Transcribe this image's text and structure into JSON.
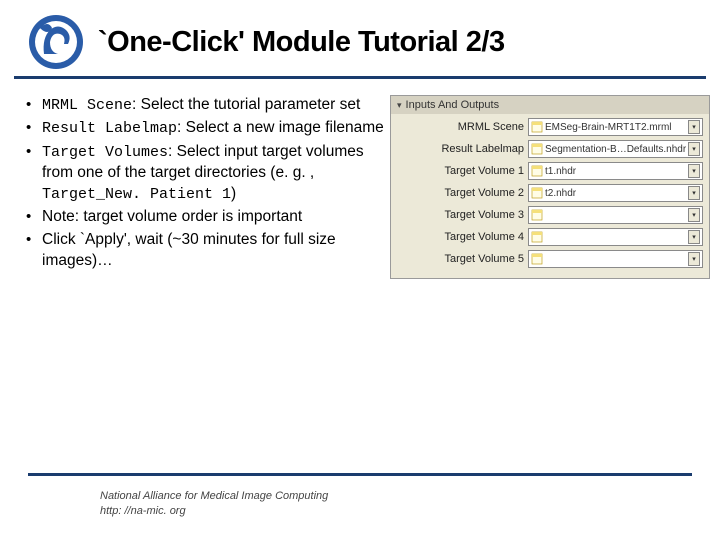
{
  "title": "`One-Click' Module Tutorial 2/3",
  "bullets": {
    "b1_mono": "MRML Scene",
    "b1_rest": ": Select the tutorial parameter set",
    "b2_mono": "Result Labelmap",
    "b2_rest": ": Select a new image filename",
    "b3_mono1": "Target Volumes",
    "b3_mid": ": Select input target volumes from one of the target directories (e. g. , ",
    "b3_mono2": "Target_New. Patient 1",
    "b3_end": ")",
    "b4": "Note: target volume order is important",
    "b5": "Click `Apply', wait (~30 minutes for full size images)…"
  },
  "panel": {
    "header": "Inputs And Outputs",
    "rows": [
      {
        "label": "MRML Scene",
        "value": "EMSeg-Brain-MRT1T2.mrml",
        "hasFile": true
      },
      {
        "label": "Result Labelmap",
        "value": "Segmentation-B…Defaults.nhdr",
        "hasFile": true
      },
      {
        "label": "Target Volume 1",
        "value": "t1.nhdr",
        "hasFile": true
      },
      {
        "label": "Target Volume 2",
        "value": "t2.nhdr",
        "hasFile": true
      },
      {
        "label": "Target Volume 3",
        "value": "",
        "hasFile": false
      },
      {
        "label": "Target Volume 4",
        "value": "",
        "hasFile": false
      },
      {
        "label": "Target Volume 5",
        "value": "",
        "hasFile": false
      }
    ]
  },
  "footer": {
    "line1": "National Alliance for Medical Image Computing",
    "line2": "http: //na-mic. org"
  }
}
